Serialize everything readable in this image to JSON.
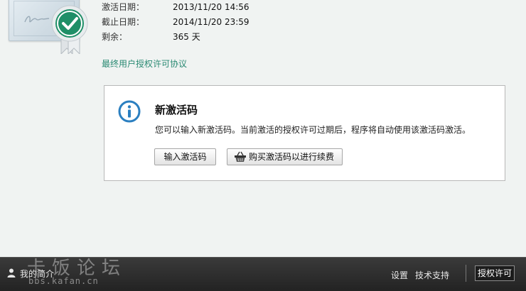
{
  "license": {
    "activation_label": "激活日期：",
    "activation_value": "2013/11/20 14:56",
    "expiry_label": "截止日期：",
    "expiry_value": "2014/11/20 23:59",
    "remaining_label": "剩余：",
    "remaining_value": "365 天"
  },
  "eula_link": "最终用户授权许可协议",
  "panel": {
    "title": "新激活码",
    "description": "您可以输入新激活码。当前激活的授权许可过期后，程序将自动使用该激活码激活。",
    "enter_button": "输入激活码",
    "buy_button": "购买激活码以进行续费"
  },
  "footer": {
    "profile_label": "我的简介",
    "watermark_main": "卡饭论坛",
    "watermark_sub": "bbs.kafan.cn",
    "settings": "设置",
    "support": "技术支持",
    "license_tab": "授权许可"
  },
  "colors": {
    "accent": "#2a8a73",
    "badge_green": "#1f8f67",
    "info_blue": "#2b7fc0",
    "footer_bg": "#2b2b2b"
  },
  "icons": {
    "certificate": "certificate-icon",
    "badge": "check-badge-icon",
    "info": "info-circle-icon",
    "basket": "basket-icon",
    "user": "user-icon"
  }
}
